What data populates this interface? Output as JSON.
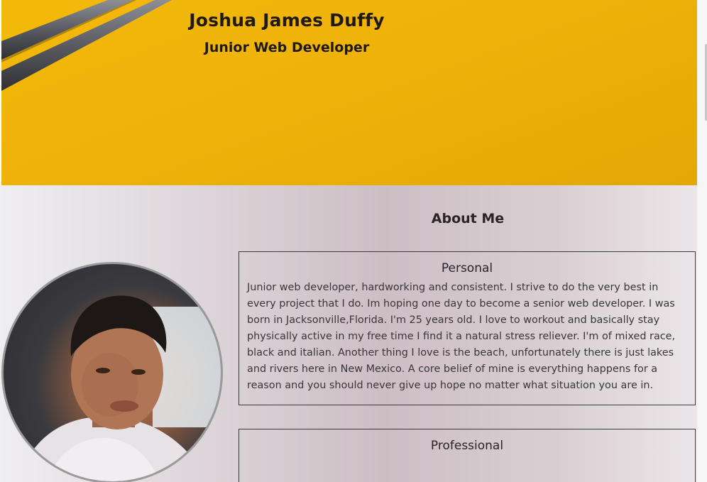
{
  "hero": {
    "name": "Joshua James Duffy",
    "title": "Junior Web Developer"
  },
  "about": {
    "heading": "About Me",
    "avatar_alt": "profile photo",
    "personal": {
      "title": "Personal",
      "text": "Junior web developer, hardworking and consistent. I strive to do the very best in every project that I do. Im hoping one day to become a senior web developer. I was born in Jacksonville,Florida. I'm 25 years old. I love to workout and basically stay physically active in my free time I find it a natural stress reliever. I'm of mixed race, black and italian. Another thing I love is the beach, unfortunately there is just lakes and rivers here in New Mexico. A core belief of mine is everything happens for a reason and you should never give up hope no matter what situation you are in."
    },
    "professional": {
      "title": "Professional"
    }
  },
  "colors": {
    "hero_background": "#f0b40a",
    "text_dark": "#1f1a10",
    "section_background": "#d6cbd0",
    "box_border": "#3d3a3d"
  }
}
